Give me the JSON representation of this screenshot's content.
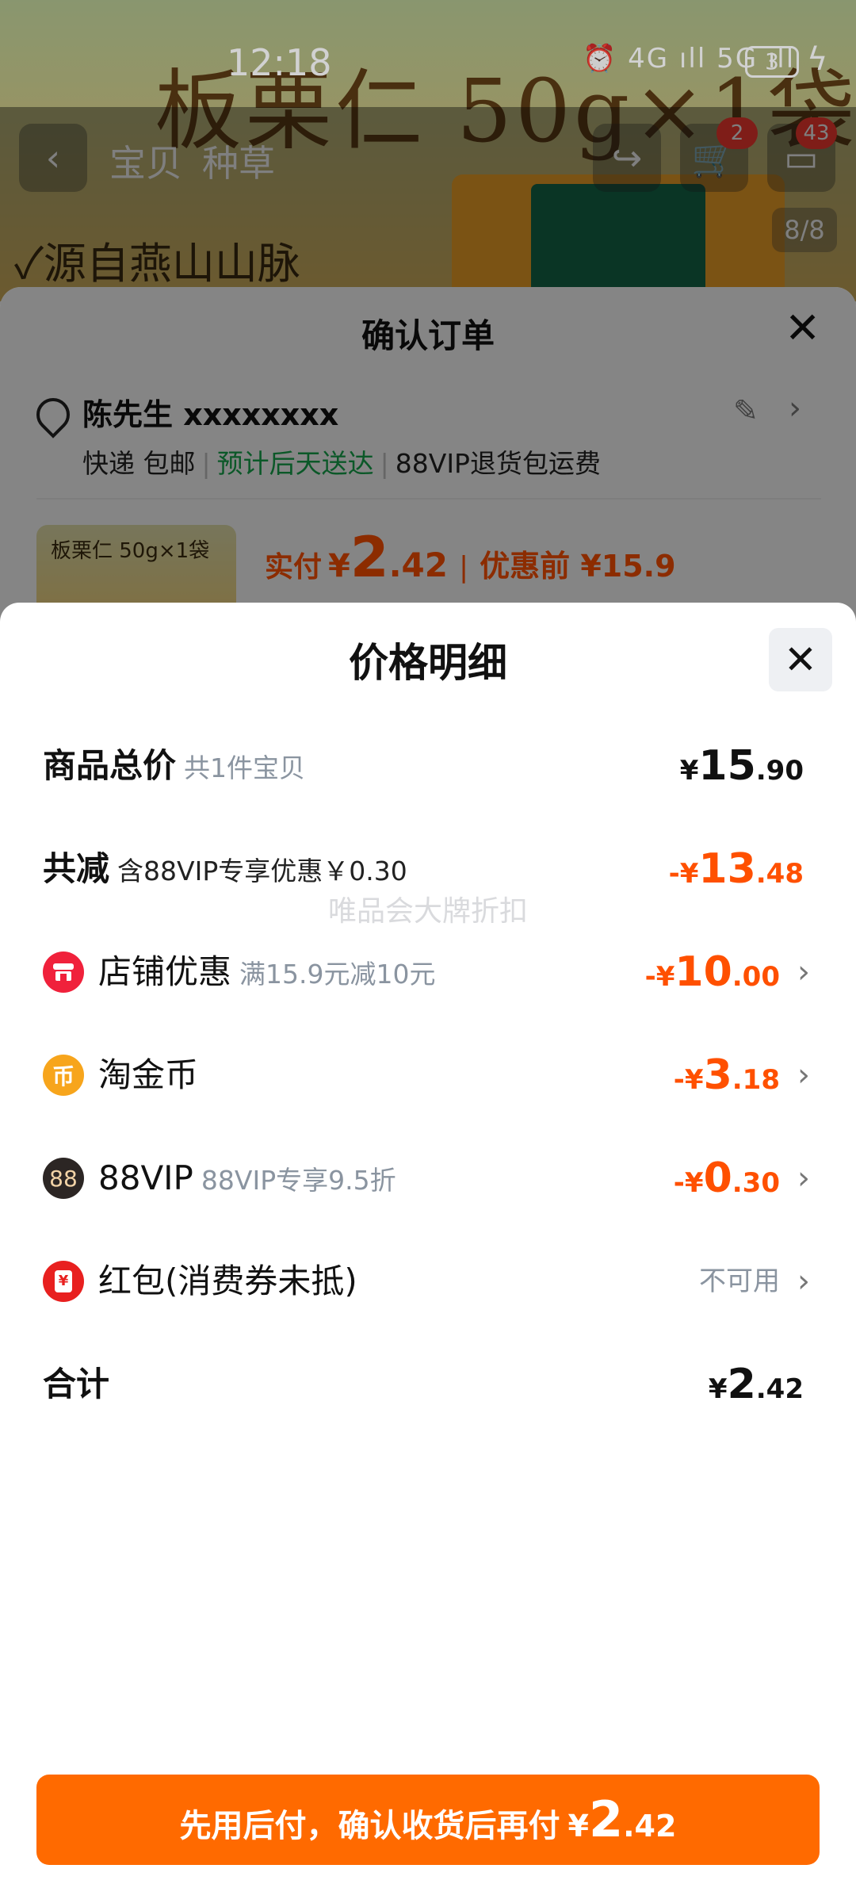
{
  "status_bar": {
    "time": "12:18",
    "network_icons": "⏰ 4G ıll 5G ıll",
    "battery": "3"
  },
  "product_page": {
    "hero_title": "板栗仁 50g×1袋",
    "hero_tagline": "✓源自燕山山脉",
    "tabs": [
      "宝贝",
      "种草"
    ],
    "cart_badge": "2",
    "message_badge": "43",
    "image_counter": "8/8"
  },
  "order_sheet": {
    "title": "确认订单",
    "address_name": "陈先生 xxxxxxxx",
    "shipping": "快递 包邮",
    "delivery_eta": "预计后天送达",
    "return_note": "88VIP退货包运费",
    "item_thumb_label": "板栗仁 50g×1袋",
    "paid_label": "实付",
    "paid_currency": "¥",
    "paid_int": "2",
    "paid_dec": ".42",
    "before_discount": "优惠前 ¥15.9"
  },
  "price_detail": {
    "title": "价格明细",
    "watermark": "唯品会大牌折扣",
    "rows": [
      {
        "label": "商品总价",
        "sub": "共1件宝贝",
        "currency": "¥",
        "amount_int": "15",
        "amount_dec": ".90"
      },
      {
        "label": "共减",
        "sub": "含88VIP专享优惠￥0.30",
        "currency": "-¥",
        "amount_int": "13",
        "amount_dec": ".48"
      },
      {
        "label": "店铺优惠",
        "sub": "满15.9元减10元",
        "currency": "-¥",
        "amount_int": "10",
        "amount_dec": ".00"
      },
      {
        "label": "淘金币",
        "sub": "",
        "currency": "-¥",
        "amount_int": "3",
        "amount_dec": ".18"
      },
      {
        "label": "88VIP",
        "sub": "88VIP专享9.5折",
        "currency": "-¥",
        "amount_int": "0",
        "amount_dec": ".30"
      },
      {
        "label": "红包(消费券未抵)",
        "sub": "",
        "status": "不可用"
      },
      {
        "label": "合计",
        "sub": "",
        "currency": "¥",
        "amount_int": "2",
        "amount_dec": ".42"
      }
    ],
    "icons": {
      "shop": "shop-icon",
      "coin": "coin-icon",
      "vip": "88vip-icon",
      "redpacket": "red-packet-icon"
    },
    "icon_glyphs": {
      "coin": "币",
      "vip": "88",
      "redpacket": "¥"
    }
  },
  "pay_button": {
    "text": "先用后付，确认收货后再付",
    "currency": "¥",
    "amount_int": "2",
    "amount_dec": ".42"
  },
  "colors": {
    "accent_orange": "#ff5000",
    "button_orange": "#ff6a00",
    "shop_icon": "#f0213b",
    "coin_icon": "#f7a51c",
    "vip_icon": "#2c2624",
    "redpacket_icon": "#e8201f",
    "delivery_green": "#14a04a"
  }
}
